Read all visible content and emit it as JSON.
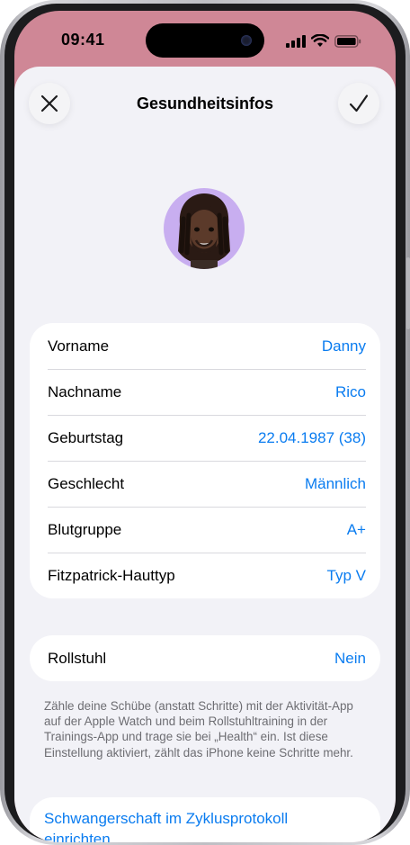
{
  "status_bar": {
    "time": "09:41"
  },
  "header": {
    "title": "Gesundheitsinfos",
    "close_icon": "close-icon",
    "done_icon": "checkmark-icon"
  },
  "profile": {
    "avatar": "memoji-avatar"
  },
  "details": {
    "rows": [
      {
        "label": "Vorname",
        "value": "Danny"
      },
      {
        "label": "Nachname",
        "value": "Rico"
      },
      {
        "label": "Geburtstag",
        "value": "22.04.1987 (38)"
      },
      {
        "label": "Geschlecht",
        "value": "Männlich"
      },
      {
        "label": "Blutgruppe",
        "value": "A+"
      },
      {
        "label": "Fitzpatrick-Hauttyp",
        "value": "Typ V"
      }
    ]
  },
  "wheelchair": {
    "label": "Rollstuhl",
    "value": "Nein",
    "footnote": "Zähle deine Schübe (anstatt Schritte) mit der Aktivität-App auf der Apple Watch und beim Rollstuhltraining in der Trainings-App und trage sie bei „Health“ ein. Ist diese Einstellung aktiviert, zählt das iPhone keine Schritte mehr."
  },
  "pregnancy": {
    "link": "Schwangerschaft im Zyklusprotokoll einrichten"
  },
  "colors": {
    "accent": "#0a7cf0",
    "header_bg": "#cf8796",
    "sheet_bg": "#f2f2f7"
  }
}
